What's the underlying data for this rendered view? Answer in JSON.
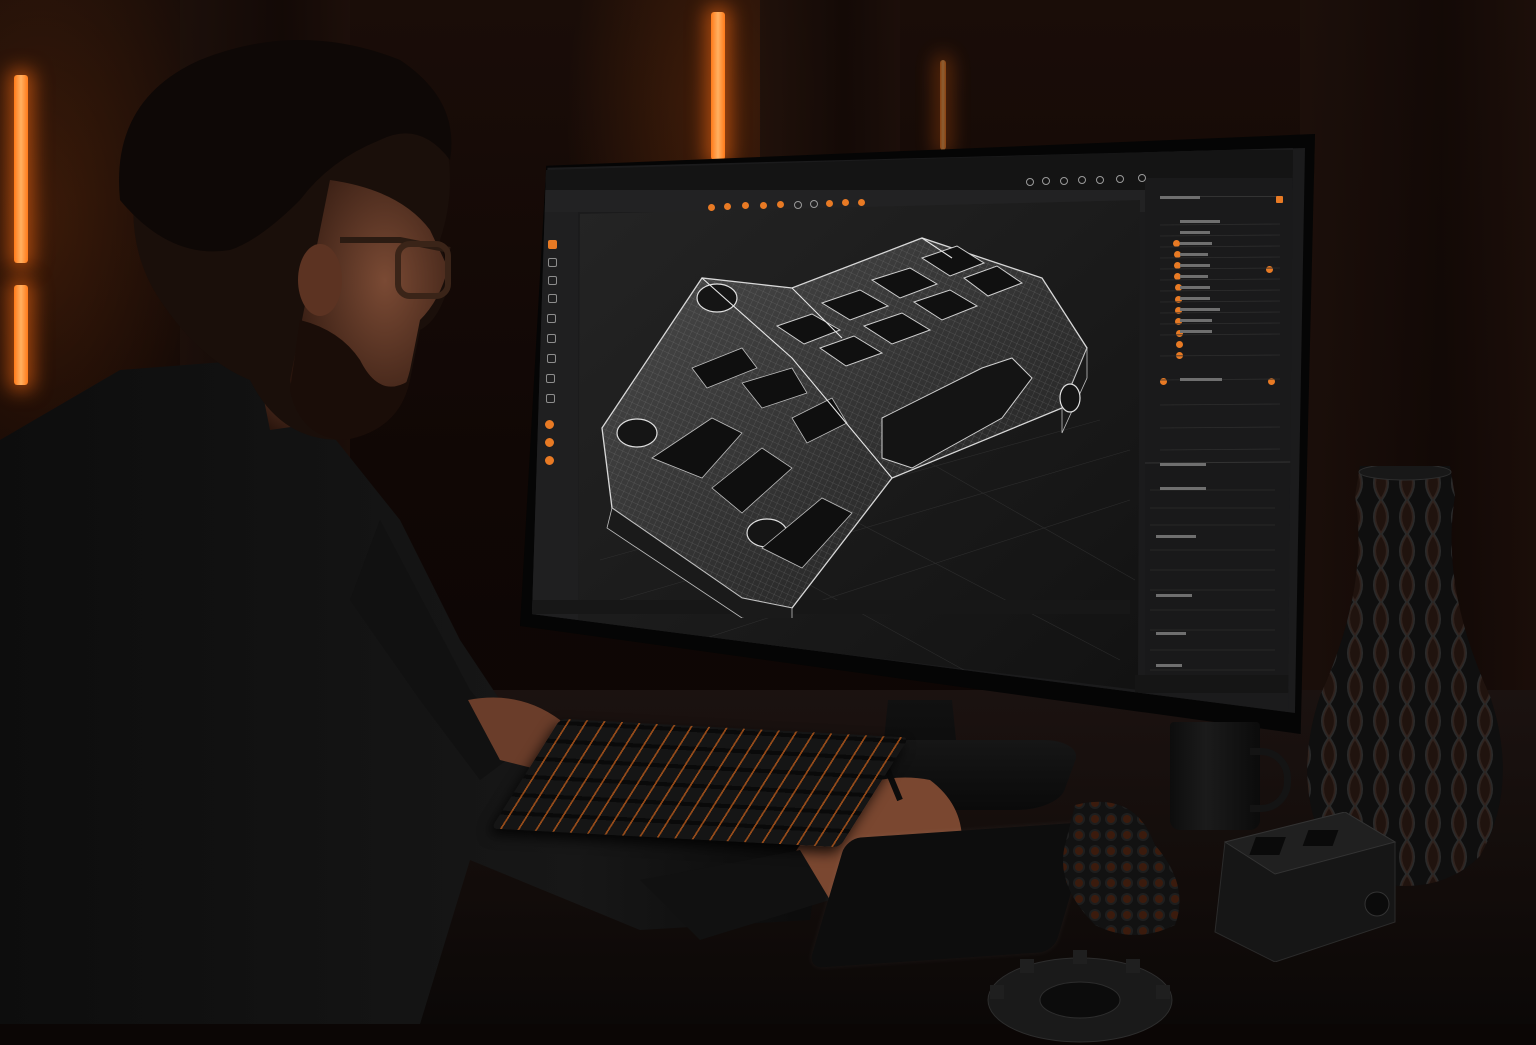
{
  "scene": {
    "description_tags": [
      "designer",
      "cad-workstation",
      "3d-model",
      "dark-studio"
    ],
    "colors": {
      "accent_orange": "#e87a24",
      "background": "#0b0605",
      "ui_dark": "#1b1b1c",
      "wireframe": "#d9d9d9"
    }
  },
  "cad_app": {
    "icons": [
      "orange-tool-icon",
      "outline-tool-icon",
      "eye-icon",
      "folder-icon",
      "gear-icon"
    ]
  }
}
